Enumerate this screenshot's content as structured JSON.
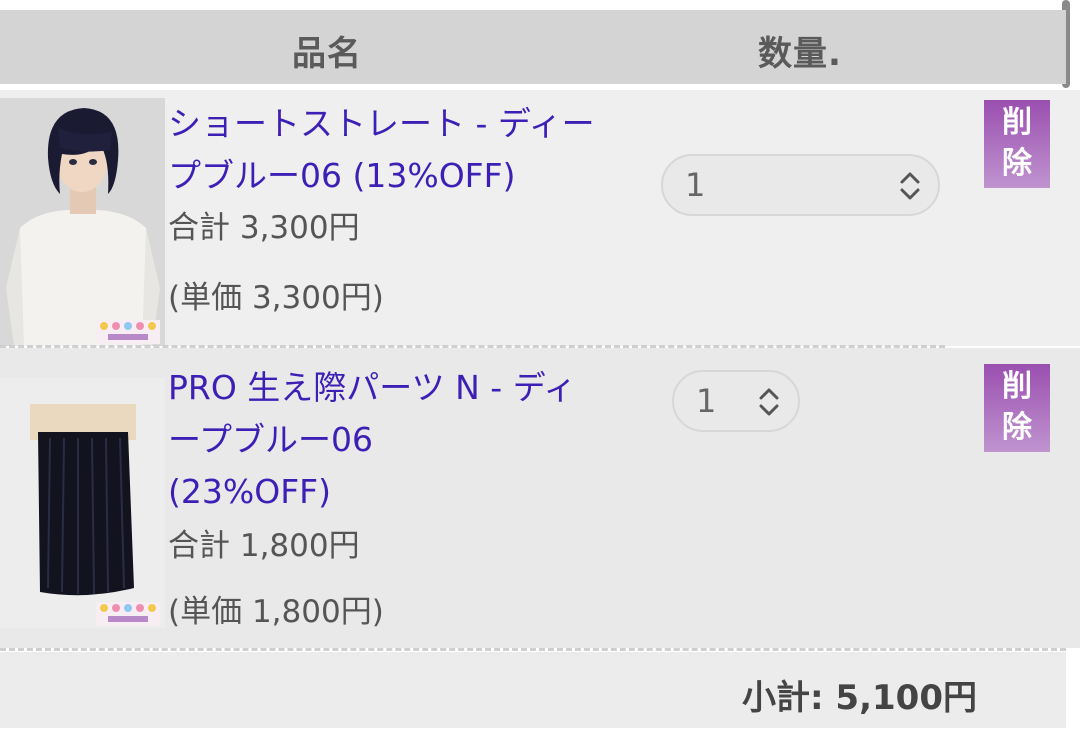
{
  "header": {
    "name_label": "品名",
    "qty_label": "数量."
  },
  "items": [
    {
      "title_lines": [
        "ショートストレート - ディー",
        "プブルー06 (13%OFF)"
      ],
      "total": "合計 3,300円",
      "unit": "(単価 3,300円)",
      "qty": "1",
      "delete_label": [
        "削",
        "除"
      ]
    },
    {
      "title_lines": [
        "PRO 生え際パーツ N - ディ",
        "ープブルー06",
        "(23%OFF)"
      ],
      "total": "合計 1,800円",
      "unit": "(単価 1,800円)",
      "qty": "1",
      "delete_label": [
        "削",
        "除"
      ]
    }
  ],
  "subtotal": "小計: 5,100円",
  "colors": {
    "link": "#3d1fb6",
    "delete_button": "#9a4fb0",
    "header_bg": "#d4d4d4"
  }
}
